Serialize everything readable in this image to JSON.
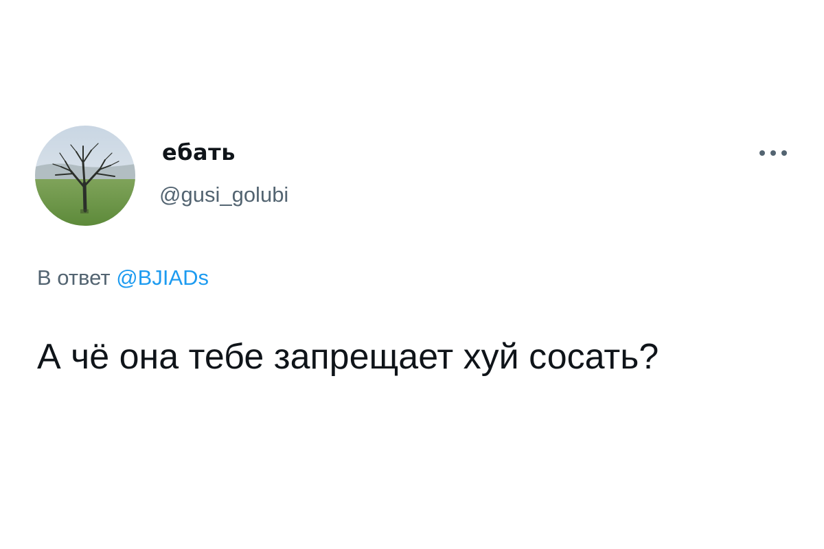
{
  "author": {
    "display_name": "ебать",
    "handle": "@gusi_golubi"
  },
  "reply": {
    "prefix": "В ответ",
    "mention": "@BJIADs"
  },
  "tweet": {
    "text": "А чё она тебе запрещает хуй сосать?"
  },
  "icons": {
    "more": "more-horizontal-icon",
    "avatar": "tree-in-field-avatar"
  },
  "colors": {
    "text_primary": "#0f1419",
    "text_secondary": "#536471",
    "link": "#1d9bf0",
    "background": "#ffffff"
  }
}
